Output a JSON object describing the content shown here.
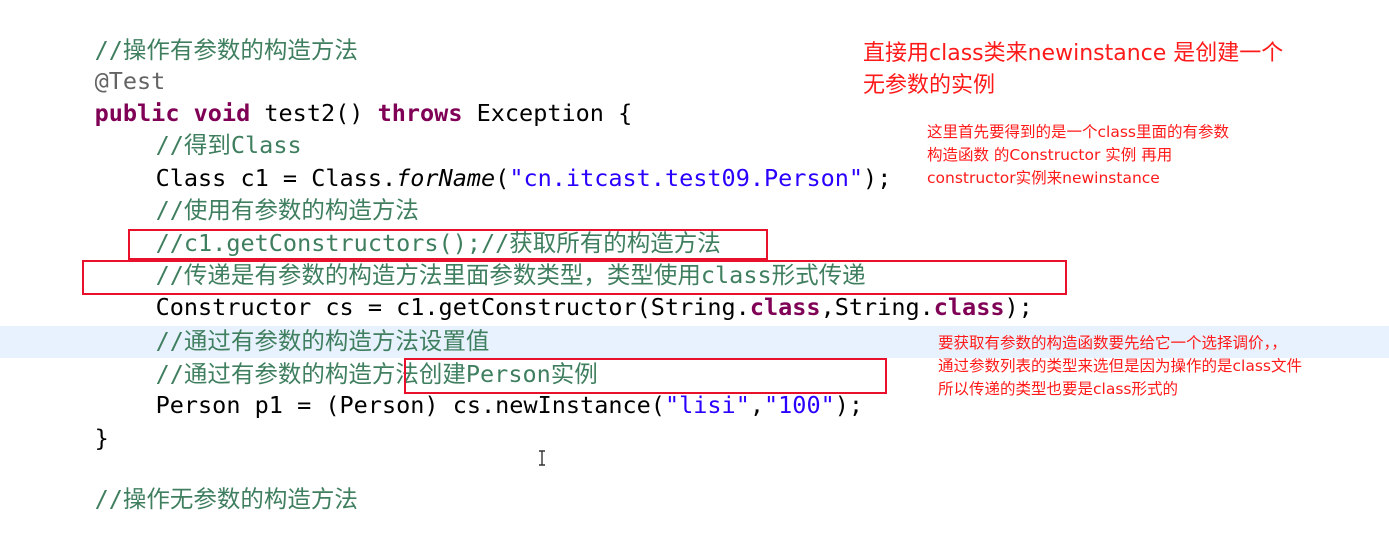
{
  "code": {
    "comment_with_params": "//操作有参数的构造方法",
    "annotation": "@Test",
    "method": {
      "kw_public": "public",
      "kw_void": "void",
      "name": " test2() ",
      "kw_throws": "throws",
      "rest": " Exception {"
    },
    "comment_get_class": "//得到Class",
    "class_line": {
      "start": "Class c1 = Class.",
      "method": "forName",
      "open": "(",
      "string": "\"cn.itcast.test09.Person\"",
      "close": ");"
    },
    "comment_use_ctor": "//使用有参数的构造方法",
    "comment_get_all": "//c1.getConstructors();//获取所有的构造方法",
    "comment_pass_type": {
      "prefix": "//",
      "text": "传递是有参数的构造方法里面参数类型，类型使用class形式传递"
    },
    "ctor_line": {
      "start": "Constructor cs = c1.getConstructor(String.",
      "kw1": "class",
      "mid": ",String.",
      "kw2": "class",
      "end": ");"
    },
    "comment_set_value": "//通过有参数的构造方法设置值",
    "comment_create": "//通过有参数的构造方法创建Person实例",
    "person_line": {
      "start": "Person p1 = (Person) ",
      "call": "cs.newInstance(",
      "s1": "\"lisi\"",
      "comma": ",",
      "s2": "\"100\"",
      "end": ");"
    },
    "brace_close": "}",
    "comment_no_params": "//操作无参数的构造方法"
  },
  "notes": {
    "top_line1": "直接用class类来newinstance  是创建一个",
    "top_line2": "无参数的实例",
    "mid_line1": "这里首先要得到的是一个class里面的有参数",
    "mid_line2": "构造函数 的Constructor 实例   再用",
    "mid_line3": "constructor实例来newinstance",
    "bot_line1": "要获取有参数的构造函数要先给它一个选择调价，，",
    "bot_line2": "通过参数列表的类型来选但是因为操作的是class文件",
    "bot_line3": "所以传递的类型也要是class形式的"
  },
  "colors": {
    "comment": "#3f7f5f",
    "keyword": "#7f0055",
    "string": "#2a00ff",
    "annotation": "#646464",
    "highlight": "#e8f2fe",
    "note_red": "#ff1a1a",
    "box_red": "#e8102a"
  },
  "icons": {
    "cursor": "text-cursor-icon"
  }
}
